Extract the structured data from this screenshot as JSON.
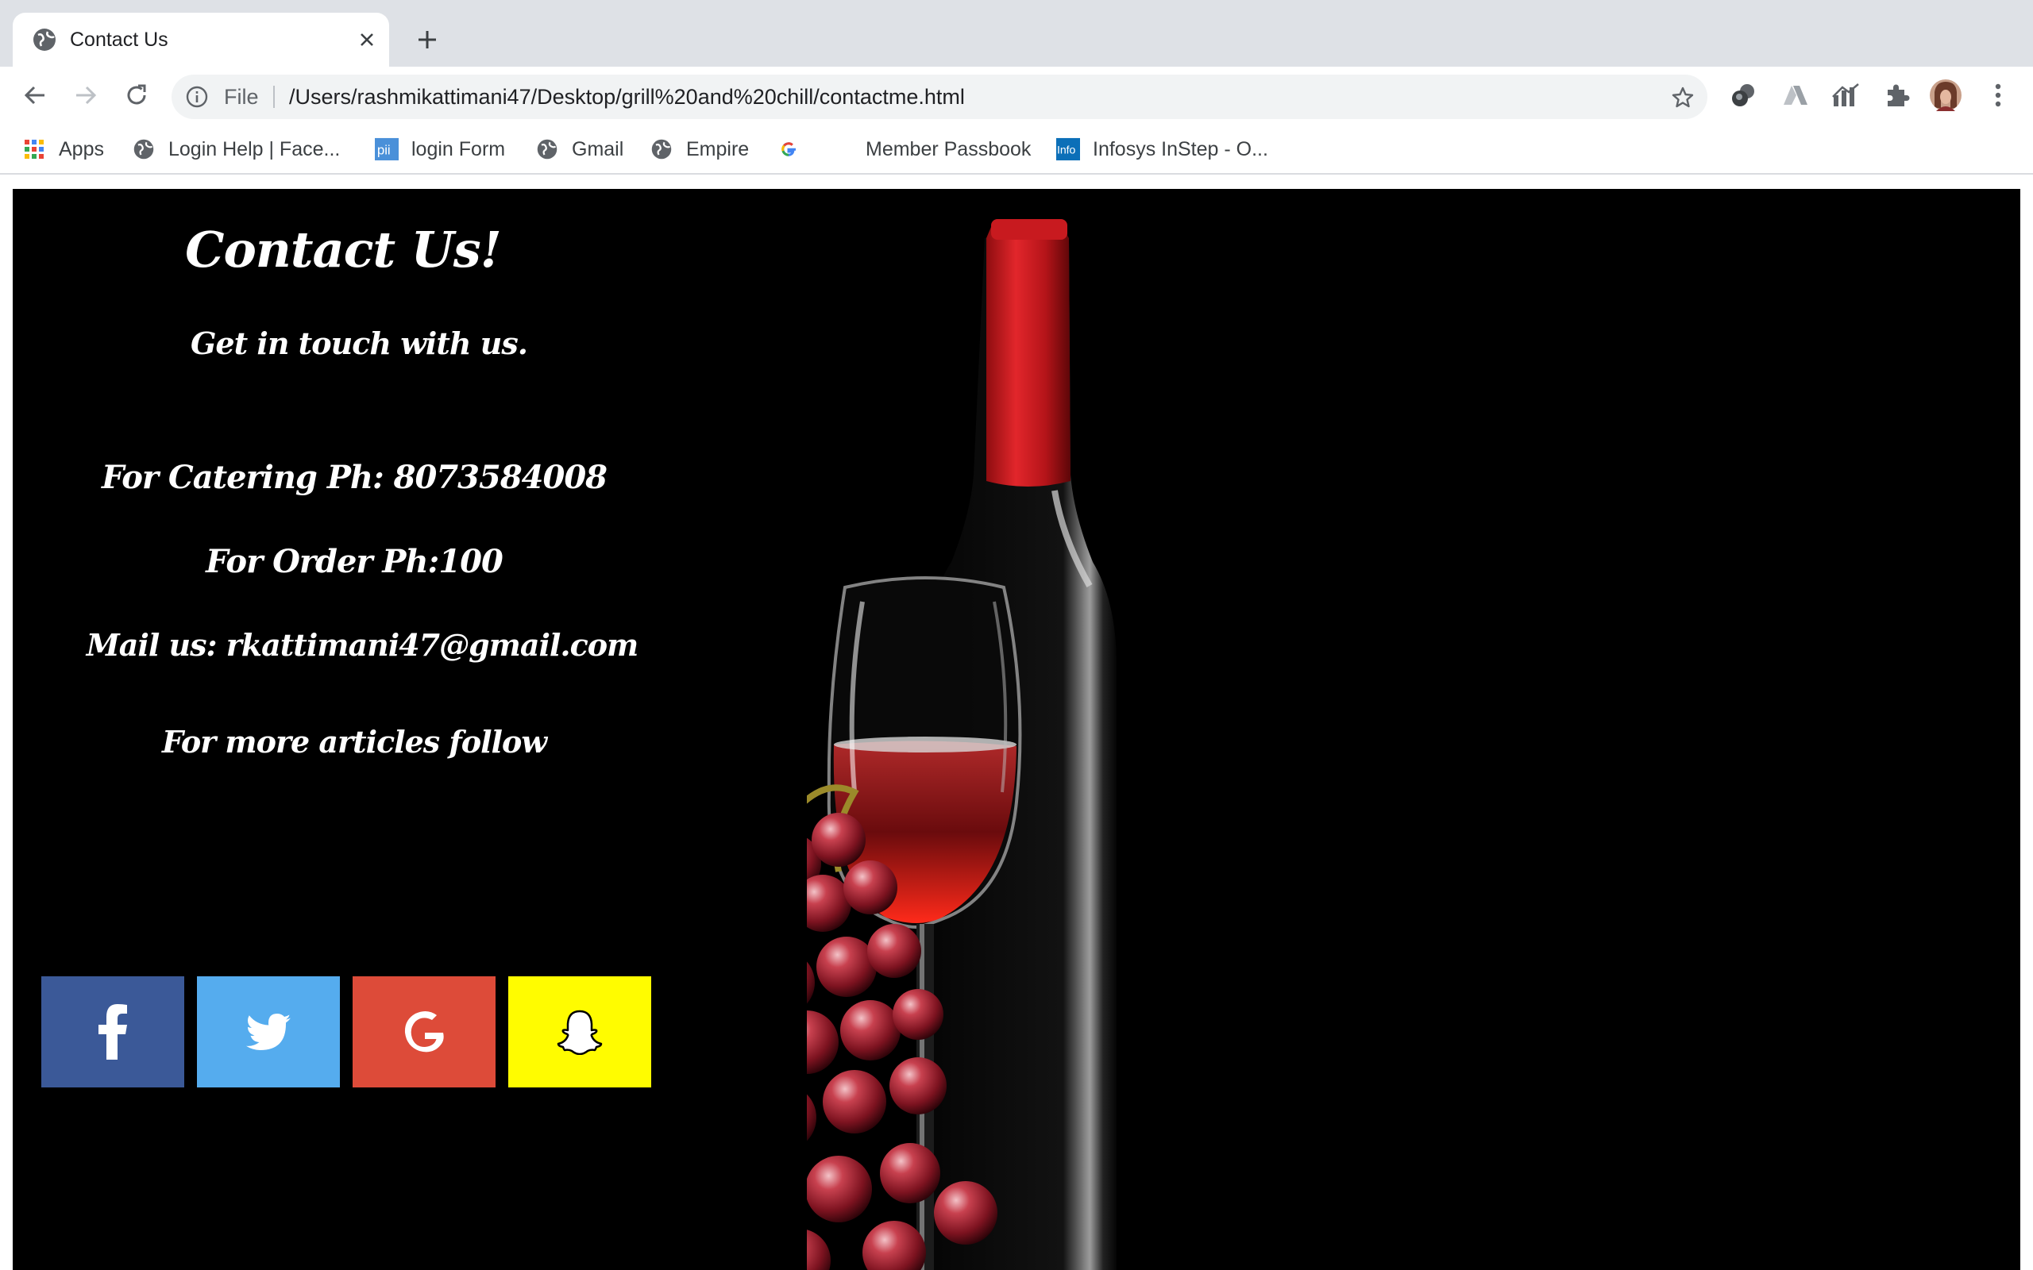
{
  "browser": {
    "tab_title": "Contact Us",
    "address": {
      "scheme_label": "File",
      "url": "/Users/rashmikattimani47/Desktop/grill%20and%20chill/contactme.html"
    },
    "bookmarks": [
      {
        "label": "Apps",
        "icon": "apps-grid-icon"
      },
      {
        "label": "Login Help | Face...",
        "icon": "globe-icon"
      },
      {
        "label": "login Form",
        "icon": "pii-logo-icon"
      },
      {
        "label": "Gmail",
        "icon": "globe-icon"
      },
      {
        "label": "Empire",
        "icon": "globe-icon"
      },
      {
        "label": "",
        "icon": "google-g-icon"
      },
      {
        "label": "Member Passbook",
        "icon": "none"
      },
      {
        "label": "Infosys InStep - O...",
        "icon": "infosys-logo-icon"
      }
    ],
    "extension_icons": [
      "circles-extension-icon",
      "ai-extension-icon",
      "analytics-extension-icon",
      "puzzle-extensions-icon",
      "profile-avatar",
      "kebab-menu-icon"
    ]
  },
  "page": {
    "heading": "Contact Us!",
    "subheading": "Get in touch with us.",
    "catering_phone": "For Catering Ph: 8073584008",
    "order_phone": "For Order Ph:100",
    "mail": "Mail us: rkattimani47@gmail.com",
    "follow_text": "For more articles follow",
    "social_buttons": [
      {
        "name": "facebook",
        "color": "#3b5998"
      },
      {
        "name": "twitter",
        "color": "#55acee"
      },
      {
        "name": "google",
        "color": "#dd4b39"
      },
      {
        "name": "snapchat",
        "color": "#fffc00"
      }
    ]
  },
  "colors": {
    "page_background": "#000000",
    "text": "#ffffff",
    "tabstrip": "#dee1e6",
    "omnibox": "#f1f3f4"
  }
}
